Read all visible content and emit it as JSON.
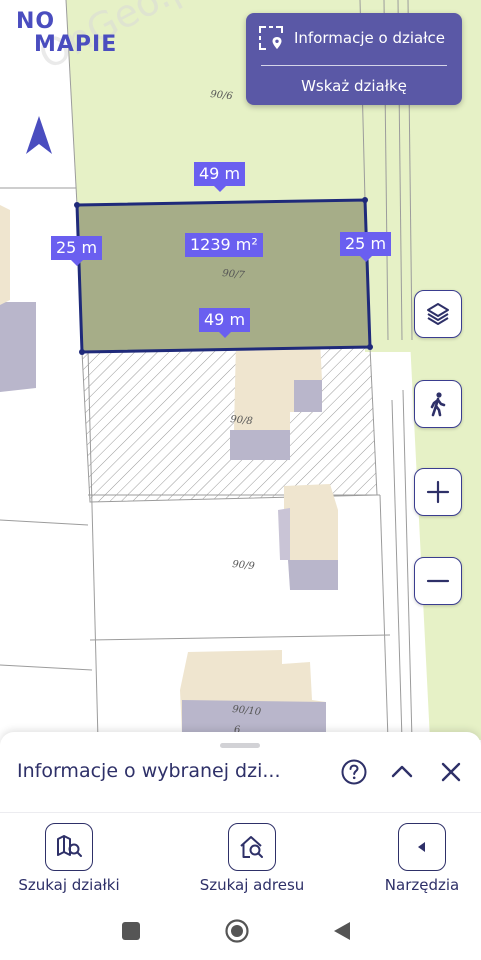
{
  "app": {
    "logo_line1": "NO",
    "logo_line2": "MAPIE"
  },
  "map": {
    "watermark": "OnGeo.pl",
    "parcel_numbers": [
      "90/6",
      "90/7",
      "90/8",
      "90/9",
      "90/10",
      "6"
    ],
    "selected_parcel": {
      "area": "1239 m²",
      "top_edge": "49 m",
      "bottom_edge": "49 m",
      "left_edge": "25 m",
      "right_edge": "25 m"
    },
    "colors": {
      "meadow": "#e6f1c6",
      "selected_fill": "#a6ad88",
      "outline": "#1f2a7a",
      "building": "#efe5cf",
      "building_shadow": "#b9b6cb",
      "label": "#6a5ff0"
    }
  },
  "info_card": {
    "title": "Informacje o działce",
    "action": "Wskaż działkę"
  },
  "map_controls": [
    "layers-icon",
    "walking-person-icon",
    "zoom-in-icon",
    "zoom-out-icon"
  ],
  "sheet": {
    "title": "Informacje o wybranej dzi..."
  },
  "bottom_nav": [
    {
      "label": "Szukaj działki",
      "icon": "map-search-icon"
    },
    {
      "label": "Szukaj adresu",
      "icon": "home-search-icon"
    },
    {
      "label": "Narzędzia",
      "icon": "chevron-left-icon"
    }
  ],
  "accent": "#5a58a6"
}
